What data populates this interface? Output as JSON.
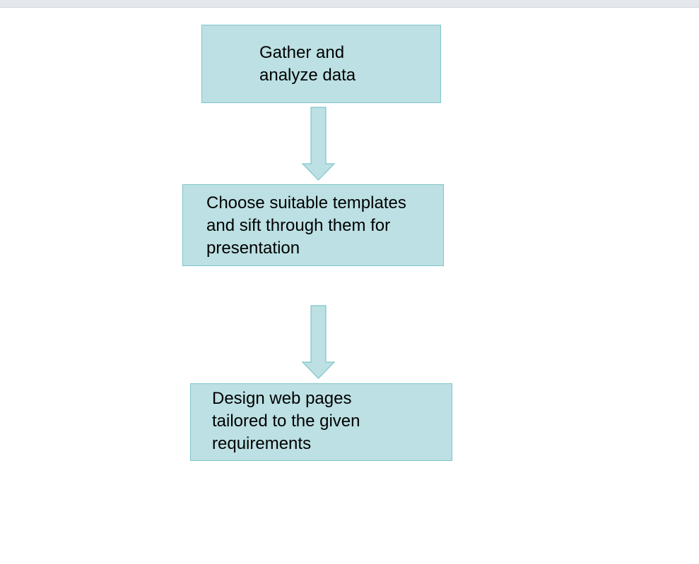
{
  "flowchart": {
    "steps": [
      {
        "label": "Gather and\nanalyze data"
      },
      {
        "label": "Choose suitable templates\nand sift through them for\npresentation"
      },
      {
        "label": "Design web pages\ntailored to the given\nrequirements"
      }
    ],
    "colors": {
      "box_fill": "#bce0e3",
      "box_border": "#7fc5c9",
      "arrow_fill": "#bce0e3",
      "arrow_stroke": "#7fc5c9",
      "text": "#000000"
    }
  }
}
